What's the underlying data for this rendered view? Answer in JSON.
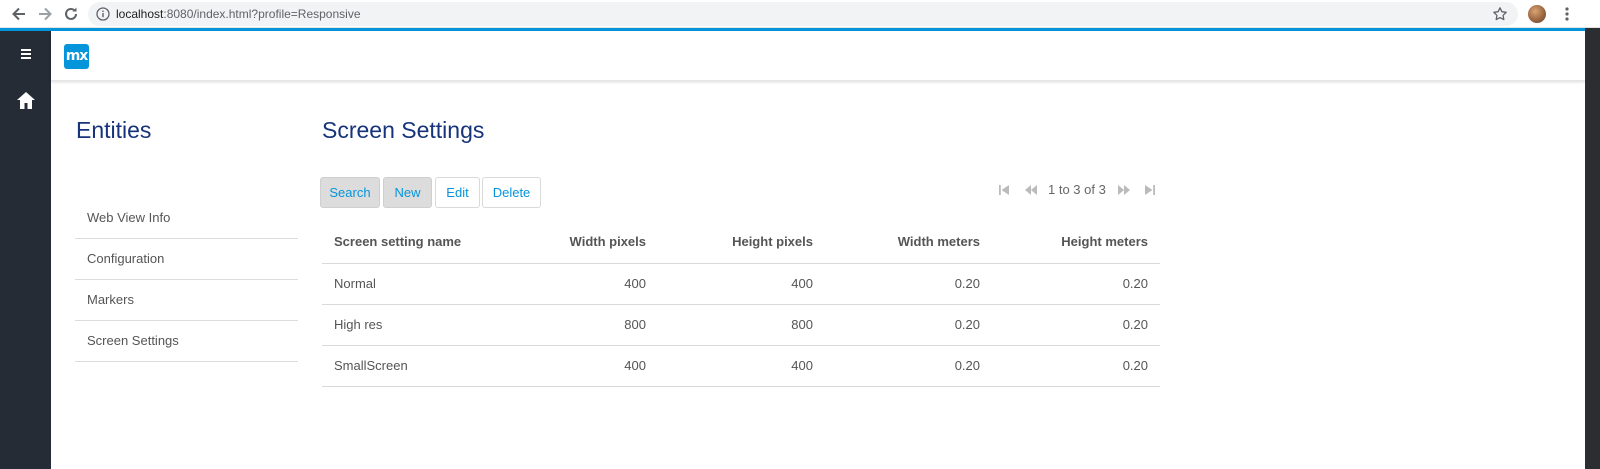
{
  "browser": {
    "url_host": "localhost",
    "url_rest": ":8080/index.html?profile=Responsive"
  },
  "icons": {
    "back": "arrow-left-icon",
    "forward": "arrow-right-icon",
    "reload": "reload-icon",
    "info": "info-icon",
    "bookmark": "star-icon",
    "menu": "hamburger-icon",
    "home": "home-icon",
    "pager_first": "first-page-icon",
    "pager_prev": "previous-page-icon",
    "pager_next": "next-page-icon",
    "pager_last": "last-page-icon"
  },
  "colors": {
    "accent": "#0595db",
    "heading": "#17347b",
    "sidebar": "#252c36"
  },
  "app": {
    "logo_text": "mx"
  },
  "entities": {
    "title": "Entities",
    "items": [
      {
        "label": "Web View Info"
      },
      {
        "label": "Configuration"
      },
      {
        "label": "Markers"
      },
      {
        "label": "Screen Settings"
      }
    ]
  },
  "screen_settings": {
    "title": "Screen Settings",
    "buttons": {
      "search": "Search",
      "new": "New",
      "edit": "Edit",
      "delete": "Delete"
    },
    "pager_text": "1 to 3 of 3",
    "columns": [
      "Screen setting name",
      "Width pixels",
      "Height pixels",
      "Width meters",
      "Height meters"
    ],
    "rows": [
      [
        "Normal",
        "400",
        "400",
        "0.20",
        "0.20"
      ],
      [
        "High res",
        "800",
        "800",
        "0.20",
        "0.20"
      ],
      [
        "SmallScreen",
        "400",
        "400",
        "0.20",
        "0.20"
      ]
    ]
  }
}
